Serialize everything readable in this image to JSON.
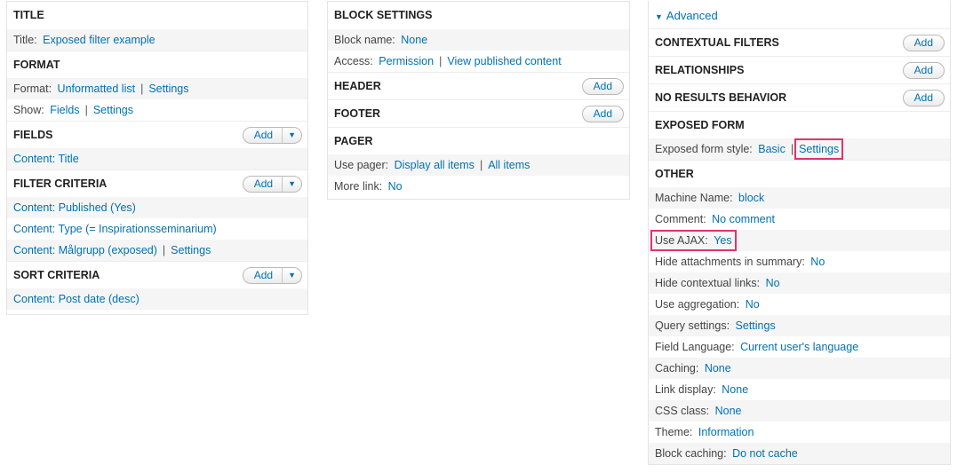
{
  "col1": {
    "title": {
      "heading": "TITLE",
      "rows": [
        {
          "label": "Title:",
          "value": "Exposed filter example"
        }
      ]
    },
    "format": {
      "heading": "FORMAT",
      "format_label": "Format:",
      "format_value": "Unformatted list",
      "format_settings": "Settings",
      "show_label": "Show:",
      "show_value": "Fields",
      "show_settings": "Settings"
    },
    "fields": {
      "heading": "FIELDS",
      "add": "Add",
      "items": [
        "Content: Title"
      ]
    },
    "filter": {
      "heading": "FILTER CRITERIA",
      "add": "Add",
      "items": [
        "Content: Published (Yes)",
        "Content: Type (= Inspirationsseminarium)",
        "Content: Målgrupp (exposed)"
      ],
      "item3_settings": "Settings"
    },
    "sort": {
      "heading": "SORT CRITERIA",
      "add": "Add",
      "items": [
        "Content: Post date (desc)"
      ]
    }
  },
  "col2": {
    "block_settings": {
      "heading": "BLOCK SETTINGS",
      "name_label": "Block name:",
      "name_value": "None",
      "access_label": "Access:",
      "access_value": "Permission",
      "access_link2": "View published content"
    },
    "header": {
      "heading": "HEADER",
      "add": "Add"
    },
    "footer": {
      "heading": "FOOTER",
      "add": "Add"
    },
    "pager": {
      "heading": "PAGER",
      "use_label": "Use pager:",
      "use_value": "Display all items",
      "use_value2": "All items",
      "more_label": "More link:",
      "more_value": "No"
    }
  },
  "col3": {
    "advanced": "Advanced",
    "contextual": {
      "heading": "CONTEXTUAL FILTERS",
      "add": "Add"
    },
    "relationships": {
      "heading": "RELATIONSHIPS",
      "add": "Add"
    },
    "no_results": {
      "heading": "NO RESULTS BEHAVIOR",
      "add": "Add"
    },
    "exposed": {
      "heading": "EXPOSED FORM",
      "style_label": "Exposed form style:",
      "style_value": "Basic",
      "style_settings": "Settings"
    },
    "other": {
      "heading": "OTHER",
      "rows": [
        {
          "label": "Machine Name:",
          "value": "block"
        },
        {
          "label": "Comment:",
          "value": "No comment"
        },
        {
          "label": "Use AJAX:",
          "value": "Yes"
        },
        {
          "label": "Hide attachments in summary:",
          "value": "No"
        },
        {
          "label": "Hide contextual links:",
          "value": "No"
        },
        {
          "label": "Use aggregation:",
          "value": "No"
        },
        {
          "label": "Query settings:",
          "value": "Settings"
        },
        {
          "label": "Field Language:",
          "value": "Current user's language"
        },
        {
          "label": "Caching:",
          "value": "None"
        },
        {
          "label": "Link display:",
          "value": "None"
        },
        {
          "label": "CSS class:",
          "value": "None"
        },
        {
          "label": "Theme:",
          "value": "Information"
        },
        {
          "label": "Block caching:",
          "value": "Do not cache"
        }
      ]
    }
  },
  "colors": {
    "link": "#0071b3",
    "highlight": "#e0336e",
    "row_alt": "#f5f5f5"
  }
}
